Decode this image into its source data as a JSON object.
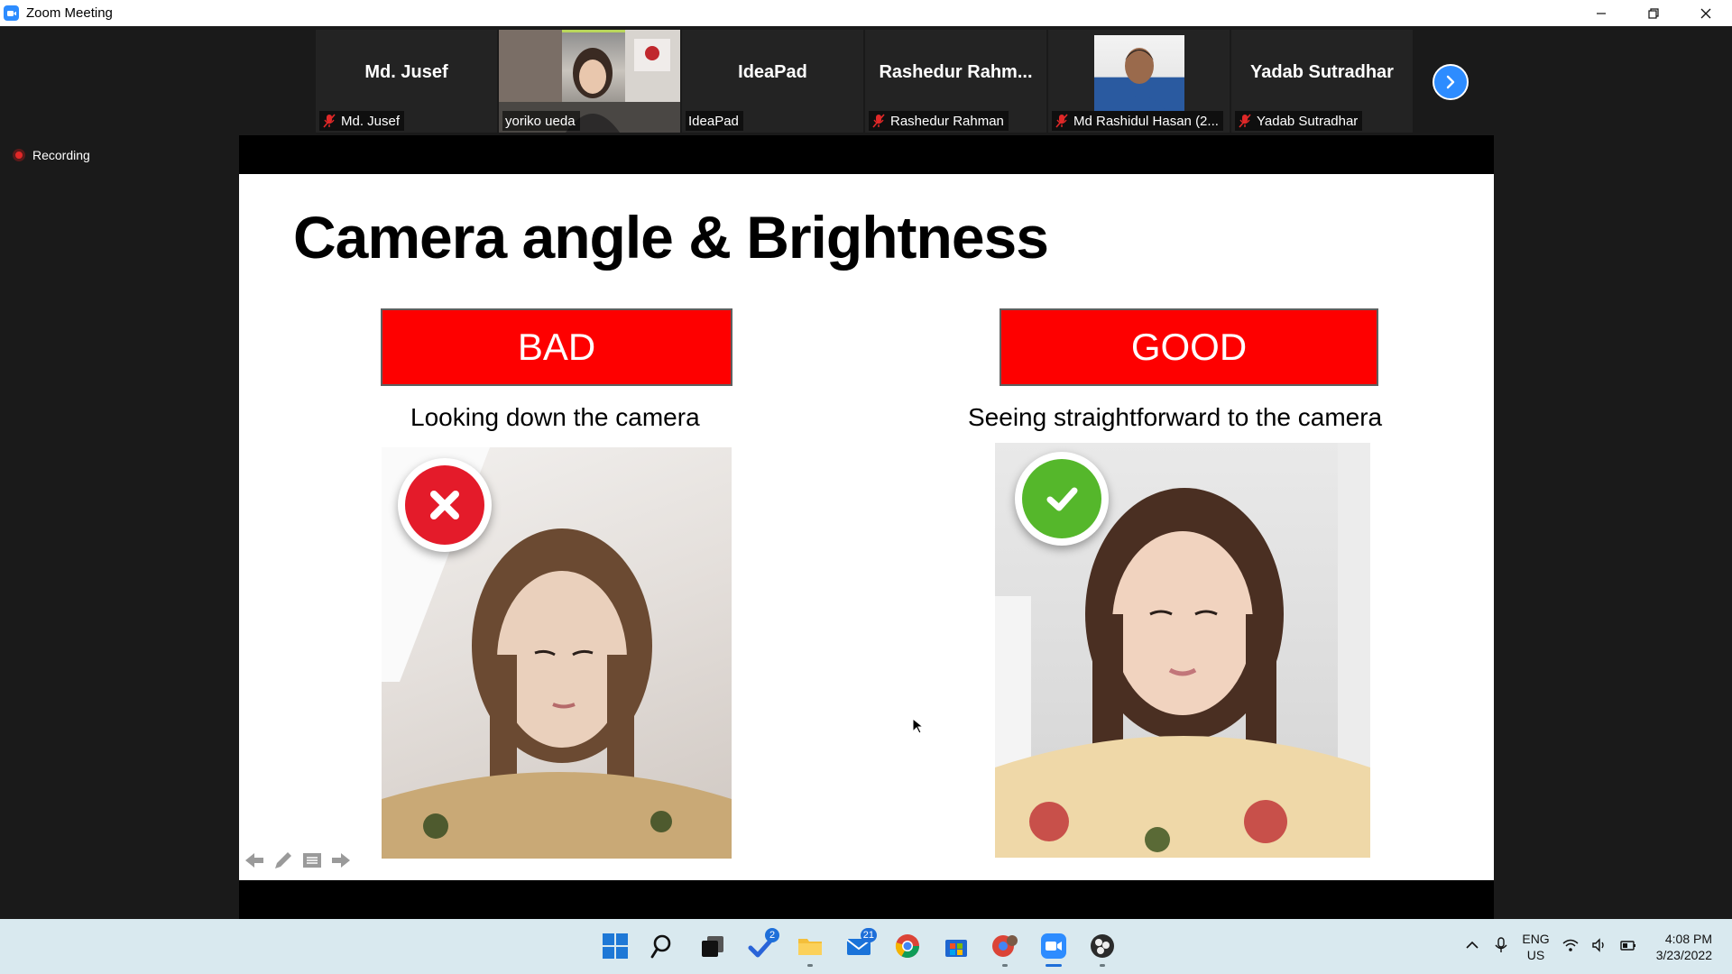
{
  "window": {
    "title": "Zoom Meeting"
  },
  "participants": [
    {
      "big_name": "Md. Jusef",
      "label": "Md. Jusef",
      "muted": true,
      "type": "name"
    },
    {
      "big_name": "",
      "label": "yoriko ueda",
      "muted": false,
      "type": "video"
    },
    {
      "big_name": "IdeaPad",
      "label": "IdeaPad",
      "muted": false,
      "type": "name"
    },
    {
      "big_name": "Rashedur  Rahm...",
      "label": "Rashedur Rahman",
      "muted": true,
      "type": "name"
    },
    {
      "big_name": "",
      "label": "Md Rashidul Hasan (2...",
      "muted": true,
      "type": "avatar"
    },
    {
      "big_name": "Yadab Sutradhar",
      "label": "Yadab Sutradhar",
      "muted": true,
      "type": "name"
    }
  ],
  "recording": {
    "label": "Recording"
  },
  "slide": {
    "title": "Camera angle & Brightness",
    "bad": {
      "verdict": "BAD",
      "caption": "Looking down the camera"
    },
    "good": {
      "verdict": "GOOD",
      "caption": "Seeing straightforward to the camera"
    }
  },
  "taskbar": {
    "icons": [
      "windows-start",
      "search",
      "task-view",
      "todo",
      "file-explorer",
      "mail",
      "chrome",
      "microsoft-store",
      "chrome-profile",
      "zoom",
      "obs"
    ],
    "todo_badge": "2",
    "mail_badge": "21"
  },
  "tray": {
    "lang_top": "ENG",
    "lang_bottom": "US",
    "time": "4:08 PM",
    "date": "3/23/2022"
  },
  "colors": {
    "zoom_blue": "#2d8cff",
    "verdict_red": "#fe0000",
    "active_speaker": "#b9d65a"
  }
}
